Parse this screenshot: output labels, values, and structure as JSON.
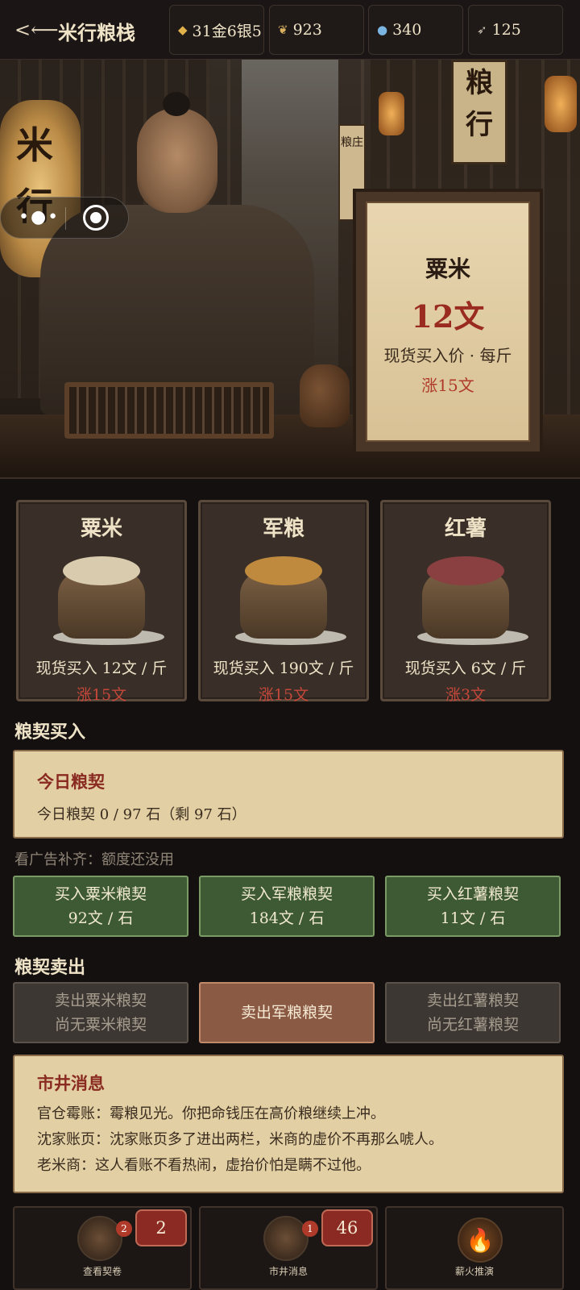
{
  "header": {
    "back_icon": "back-arrow-icon",
    "title": "米行粮栈",
    "resources": [
      {
        "icon": "gold-ingot-icon",
        "value": "31金6银5"
      },
      {
        "icon": "grain-icon",
        "value": "923"
      },
      {
        "icon": "water-drop-icon",
        "value": "340"
      },
      {
        "icon": "feather-icon",
        "value": "125"
      }
    ]
  },
  "hero": {
    "lantern_text": [
      "米",
      "行"
    ],
    "shop_sign": [
      "粮",
      "行"
    ],
    "street_sign": "粮庄",
    "controls": {
      "more_icon": "more-dots-icon",
      "record_icon": "record-icon"
    },
    "board": {
      "name": "粟米",
      "price": "12文",
      "subtitle": "现货买入价 · 每斤",
      "change": "涨15文"
    }
  },
  "products": [
    {
      "name": "粟米",
      "price": "现货买入 12文 / 斤",
      "change": "涨15文",
      "fill_color": "#d9ccae"
    },
    {
      "name": "军粮",
      "price": "现货买入 190文 / 斤",
      "change": "涨15文",
      "fill_color": "#c08a3e"
    },
    {
      "name": "红薯",
      "price": "现货买入 6文 / 斤",
      "change": "涨3文",
      "fill_color": "#8a4040"
    }
  ],
  "buy_section": {
    "heading": "粮契买入",
    "panel_title": "今日粮契",
    "panel_text": "今日粮契 0 / 97 石（剩 97 石）",
    "hint": "看广告补齐：额度还没用",
    "buttons": [
      {
        "line1": "买入粟米粮契",
        "line2": "92文 / 石"
      },
      {
        "line1": "买入军粮粮契",
        "line2": "184文 / 石"
      },
      {
        "line1": "买入红薯粮契",
        "line2": "11文 / 石"
      }
    ]
  },
  "sell_section": {
    "heading": "粮契卖出",
    "buttons": [
      {
        "line1": "卖出粟米粮契",
        "line2": "尚无粟米粮契",
        "state": "disabled"
      },
      {
        "line1": "卖出军粮粮契",
        "line2": "",
        "state": "active"
      },
      {
        "line1": "卖出红薯粮契",
        "line2": "尚无红薯粮契",
        "state": "disabled"
      }
    ]
  },
  "news": {
    "title": "市井消息",
    "lines": [
      "官仓霉账：霉粮见光。你把命钱压在高价粮继续上冲。",
      "沈家账页：沈家账页多了进出两栏，米商的虚价不再那么唬人。",
      "老米商：这人看账不看热闹，虚抬价怕是瞒不过他。"
    ]
  },
  "bottom_bar": [
    {
      "icon": "scroll-icon",
      "badge": "2",
      "count": "2",
      "label": "查看契卷"
    },
    {
      "icon": "scroll-icon",
      "badge": "1",
      "count": "46",
      "label": "市井消息"
    },
    {
      "icon": "fire-icon",
      "label": "薪火推演"
    }
  ],
  "colors": {
    "accent_red": "#c4473a",
    "buy_green": "#3d5a35",
    "sell_active": "#8a5a45",
    "panel_bg": "#e2cfa4"
  }
}
